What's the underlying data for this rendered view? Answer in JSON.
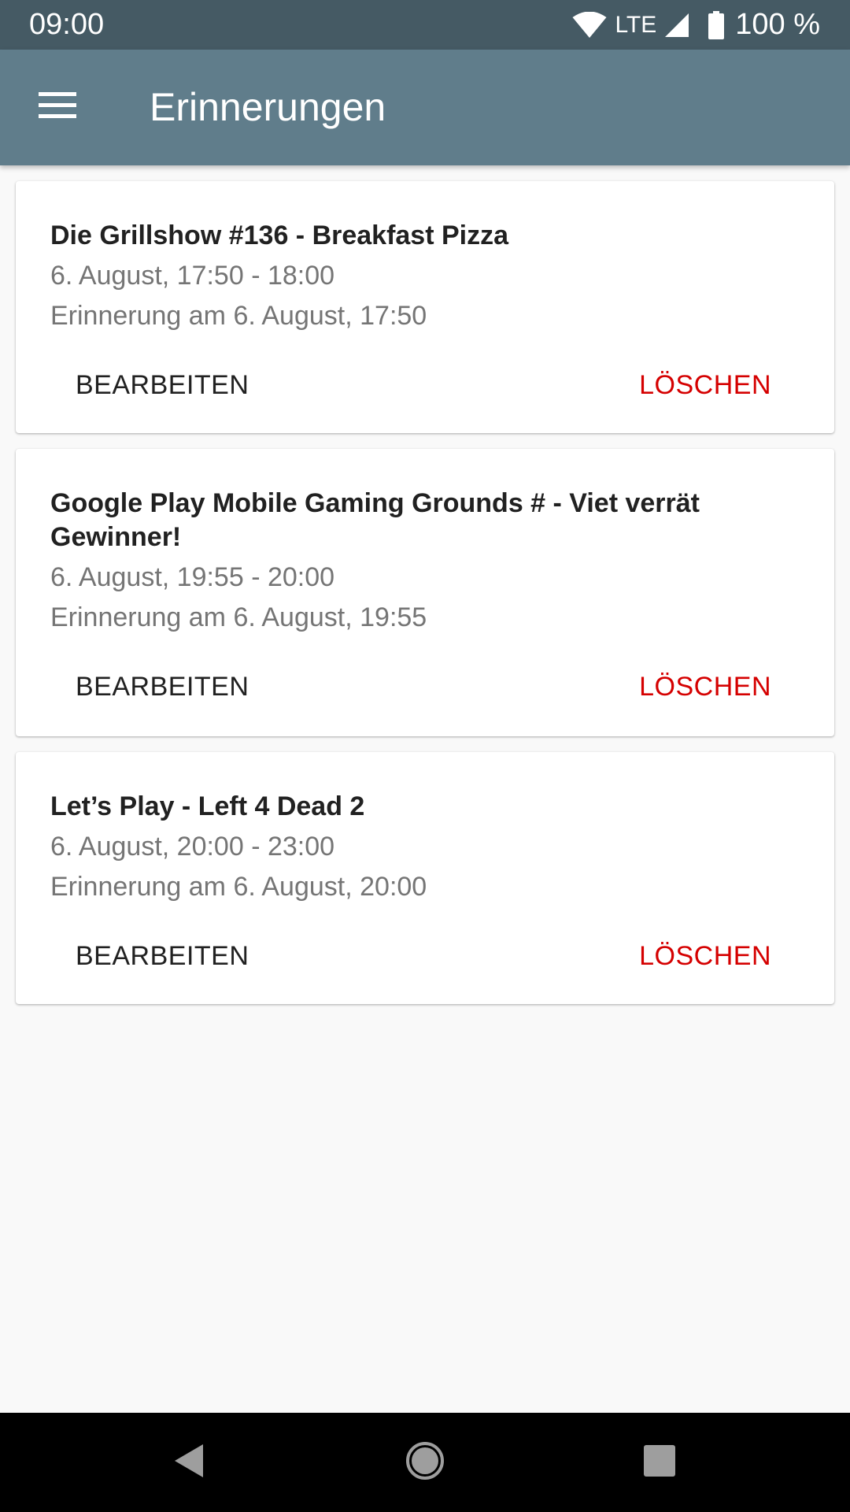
{
  "status_bar": {
    "time": "09:00",
    "network": "LTE",
    "battery": "100 %",
    "icons": [
      "wifi-icon",
      "signal-icon",
      "battery-icon"
    ]
  },
  "app_bar": {
    "title": "Erinnerungen",
    "menu_icon": "hamburger-menu-icon"
  },
  "reminders": [
    {
      "title": "Die Grillshow #136 - Breakfast Pizza",
      "time_range": "6. August, 17:50 - 18:00",
      "reminder": "Erinnerung am 6. August, 17:50",
      "edit_label": "BEARBEITEN",
      "delete_label": "LÖSCHEN"
    },
    {
      "title": "Google Play Mobile Gaming Grounds # - Viet verrät Gewinner!",
      "time_range": "6. August, 19:55 - 20:00",
      "reminder": "Erinnerung am 6. August, 19:55",
      "edit_label": "BEARBEITEN",
      "delete_label": "LÖSCHEN"
    },
    {
      "title": "Let’s Play  - Left 4 Dead 2",
      "time_range": "6. August, 20:00 - 23:00",
      "reminder": "Erinnerung am 6. August, 20:00",
      "edit_label": "BEARBEITEN",
      "delete_label": "LÖSCHEN"
    }
  ],
  "colors": {
    "status_bar": "#455a64",
    "app_bar": "#607d8b",
    "delete_accent": "#d50000",
    "background": "#f9f9f9"
  },
  "nav_bar": {
    "icons": [
      "back-icon",
      "home-icon",
      "recents-icon"
    ]
  }
}
